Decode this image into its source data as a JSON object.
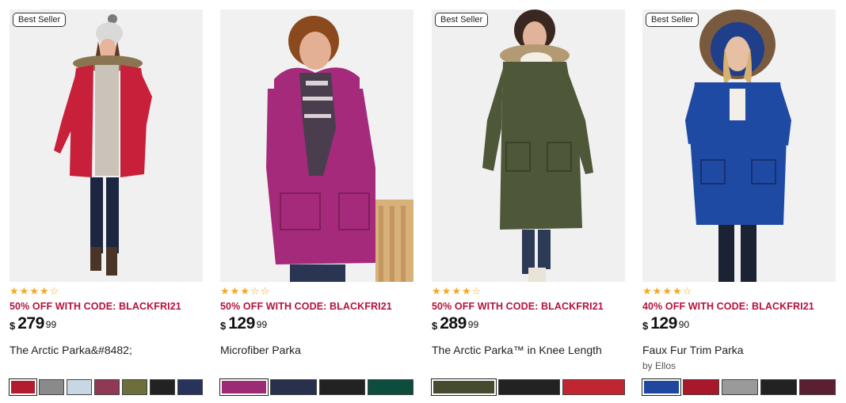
{
  "products": [
    {
      "badge": "Best Seller",
      "rating": 4,
      "promo": "50% OFF WITH CODE: BLACKFRI21",
      "currency": "$",
      "price_whole": "279",
      "price_cents": "99",
      "name": "The Arctic Parka&#8482;",
      "brand": "",
      "coat_color": "#c8203a",
      "swatches": [
        "#b11d2e",
        "#8a8a8a",
        "#c9d6e3",
        "#8e3a55",
        "#6c6e3c",
        "#222222",
        "#27335a"
      ]
    },
    {
      "badge": "",
      "rating": 3,
      "promo": "50% OFF WITH CODE: BLACKFRI21",
      "currency": "$",
      "price_whole": "129",
      "price_cents": "99",
      "name": "Microfiber Parka",
      "brand": "",
      "coat_color": "#a52a7c",
      "swatches": [
        "#9c2a74",
        "#27304d",
        "#222222",
        "#0d4d3d"
      ]
    },
    {
      "badge": "Best Seller",
      "rating": 4,
      "promo": "50% OFF WITH CODE: BLACKFRI21",
      "currency": "$",
      "price_whole": "289",
      "price_cents": "99",
      "name": "The Arctic Parka™ in Knee Length",
      "brand": "",
      "coat_color": "#4e5738",
      "swatches": [
        "#444b2f",
        "#222222",
        "#c1252f"
      ]
    },
    {
      "badge": "Best Seller",
      "rating": 4,
      "promo": "40% OFF WITH CODE: BLACKFRI21",
      "currency": "$",
      "price_whole": "129",
      "price_cents": "90",
      "name": "Faux Fur Trim Parka",
      "brand": "by Ellos",
      "coat_color": "#1f4aa3",
      "swatches": [
        "#1f47a0",
        "#a8182a",
        "#9a9a9a",
        "#222222",
        "#5a1f30"
      ]
    }
  ]
}
